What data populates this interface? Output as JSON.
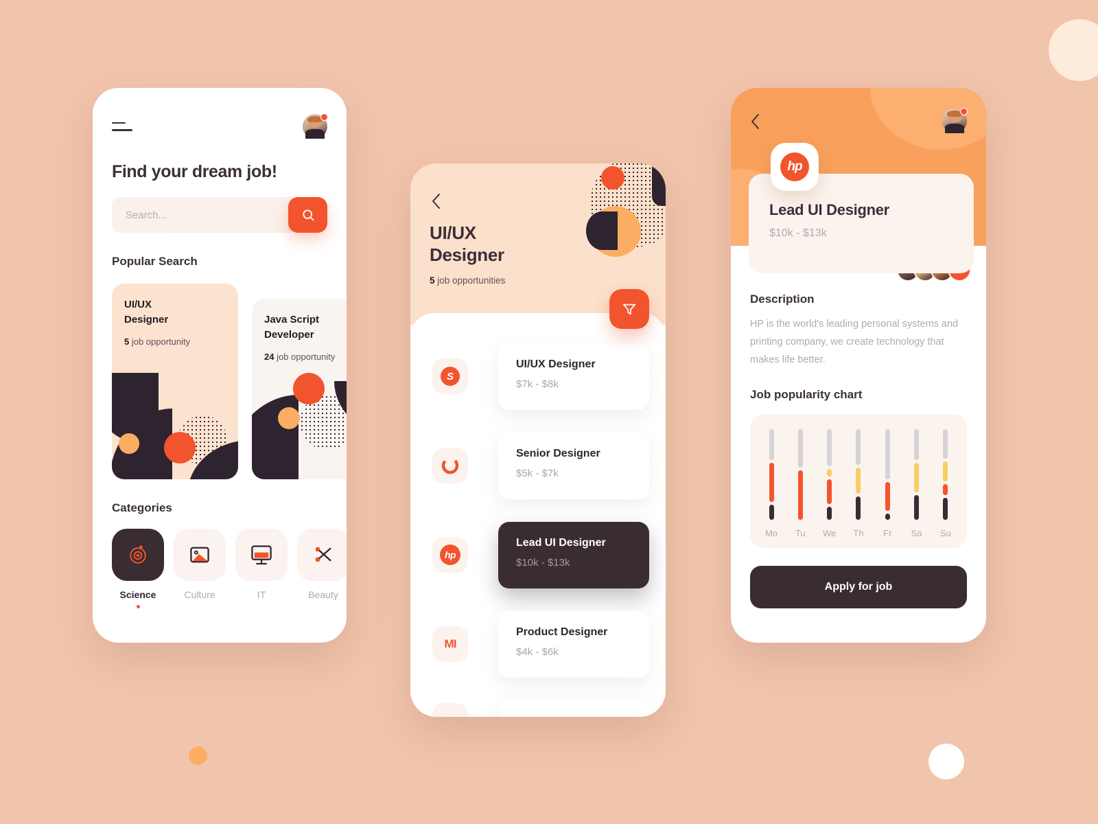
{
  "theme": {
    "background": "#F1C4AC",
    "accent_orange": "#F2542D",
    "accent_amber": "#F9A05C",
    "dark": "#3A2C33",
    "cream": "#FBE3CF",
    "yellow": "#F8CE63",
    "gray": "#D6D3D6"
  },
  "screen1": {
    "menu_icon": "hamburger-icon",
    "avatar_icon": "user-avatar",
    "title": "Find your dream job!",
    "search": {
      "placeholder": "Search...",
      "value": "",
      "button_icon": "search-icon"
    },
    "popular_search_heading": "Popular Search",
    "popular_cards": [
      {
        "title": "UI/UX\nDesigner",
        "count": "5",
        "count_suffix": " job opportunity"
      },
      {
        "title": "Java Script\nDeveloper",
        "count": "24",
        "count_suffix": " job opportunity"
      }
    ],
    "categories_heading": "Categories",
    "categories": [
      {
        "label": "Science",
        "icon": "atom-icon",
        "active": true
      },
      {
        "label": "Culture",
        "icon": "image-icon",
        "active": false
      },
      {
        "label": "IT",
        "icon": "monitor-icon",
        "active": false
      },
      {
        "label": "Beauty",
        "icon": "scissors-icon",
        "active": false
      }
    ]
  },
  "screen2": {
    "back_icon": "chevron-left-icon",
    "title": "UI/UX\nDesigner",
    "opportunities_count": "5",
    "opportunities_suffix": " job opportunities",
    "filter_icon": "filter-icon",
    "jobs": [
      {
        "logo": "skype-logo",
        "logo_text": "S",
        "title": "UI/UX Designer",
        "salary": "$7k - $8k",
        "active": false
      },
      {
        "logo": "vodafone-logo",
        "logo_text": "O",
        "title": "Senior Designer",
        "salary": "$5k - $7k",
        "active": false
      },
      {
        "logo": "hp-logo",
        "logo_text": "hp",
        "title": "Lead UI Designer",
        "salary": "$10k - $13k",
        "active": true
      },
      {
        "logo": "xiaomi-logo",
        "logo_text": "MI",
        "title": "Product Designer",
        "salary": "$4k - $6k",
        "active": false
      }
    ]
  },
  "screen3": {
    "back_icon": "chevron-left-icon",
    "avatar_icon": "user-avatar",
    "company_logo": "hp-logo",
    "job_title": "Lead UI Designer",
    "salary": "$10k - $13k",
    "people_more_label": "•••",
    "description_heading": "Description",
    "description_text": "HP is the world's leading personal systems and printing company, we create technology that makes life better.",
    "chart_heading": "Job popularity chart",
    "apply_label": "Apply for job",
    "chart_data": {
      "type": "bar",
      "title": "Job popularity chart",
      "categories": [
        "Mo",
        "Tu",
        "We",
        "Th",
        "Fr",
        "Sa",
        "Su"
      ],
      "xlabel": "",
      "ylabel": "",
      "legend": [
        "gray (remaining)",
        "yellow",
        "orange",
        "dark"
      ],
      "stacks": [
        {
          "day": "Mo",
          "segments": [
            {
              "color": "gray",
              "value": 34
            },
            {
              "color": "orange",
              "value": 43
            },
            {
              "color": "dark",
              "value": 17
            }
          ]
        },
        {
          "day": "Tu",
          "segments": [
            {
              "color": "gray",
              "value": 42
            },
            {
              "color": "orange",
              "value": 55
            }
          ]
        },
        {
          "day": "We",
          "segments": [
            {
              "color": "gray",
              "value": 42
            },
            {
              "color": "yellow",
              "value": 9
            },
            {
              "color": "orange",
              "value": 28
            },
            {
              "color": "dark",
              "value": 15
            }
          ]
        },
        {
          "day": "Th",
          "segments": [
            {
              "color": "gray",
              "value": 38
            },
            {
              "color": "yellow",
              "value": 28
            },
            {
              "color": "dark",
              "value": 25
            }
          ]
        },
        {
          "day": "Fr",
          "segments": [
            {
              "color": "gray",
              "value": 55
            },
            {
              "color": "orange",
              "value": 32
            },
            {
              "color": "dark",
              "value": 7
            }
          ]
        },
        {
          "day": "Sa",
          "segments": [
            {
              "color": "gray",
              "value": 33
            },
            {
              "color": "yellow",
              "value": 32
            },
            {
              "color": "dark",
              "value": 27
            }
          ]
        },
        {
          "day": "Su",
          "segments": [
            {
              "color": "gray",
              "value": 33
            },
            {
              "color": "yellow",
              "value": 22
            },
            {
              "color": "orange",
              "value": 12
            },
            {
              "color": "dark",
              "value": 25
            }
          ]
        }
      ]
    }
  }
}
